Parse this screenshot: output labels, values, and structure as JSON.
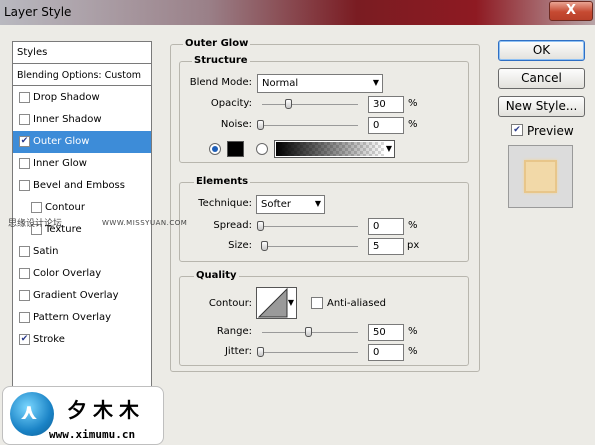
{
  "window": {
    "title": "Layer Style",
    "close_glyph": "X"
  },
  "styles": {
    "header": "Styles",
    "blending": "Blending Options: Custom",
    "items": [
      {
        "label": "Drop Shadow",
        "checked": false,
        "selected": false,
        "indent": false,
        "has_checkbox": true
      },
      {
        "label": "Inner Shadow",
        "checked": false,
        "selected": false,
        "indent": false,
        "has_checkbox": true
      },
      {
        "label": "Outer Glow",
        "checked": true,
        "selected": true,
        "indent": false,
        "has_checkbox": true
      },
      {
        "label": "Inner Glow",
        "checked": false,
        "selected": false,
        "indent": false,
        "has_checkbox": true
      },
      {
        "label": "Bevel and Emboss",
        "checked": false,
        "selected": false,
        "indent": false,
        "has_checkbox": true
      },
      {
        "label": "Contour",
        "checked": false,
        "selected": false,
        "indent": true,
        "has_checkbox": true
      },
      {
        "label": "Texture",
        "checked": false,
        "selected": false,
        "indent": true,
        "has_checkbox": true
      },
      {
        "label": "Satin",
        "checked": false,
        "selected": false,
        "indent": false,
        "has_checkbox": true
      },
      {
        "label": "Color Overlay",
        "checked": false,
        "selected": false,
        "indent": false,
        "has_checkbox": true
      },
      {
        "label": "Gradient Overlay",
        "checked": false,
        "selected": false,
        "indent": false,
        "has_checkbox": true
      },
      {
        "label": "Pattern Overlay",
        "checked": false,
        "selected": false,
        "indent": false,
        "has_checkbox": true
      },
      {
        "label": "Stroke",
        "checked": true,
        "selected": false,
        "indent": false,
        "has_checkbox": true
      }
    ]
  },
  "outer_glow": {
    "title": "Outer Glow",
    "structure": {
      "title": "Structure",
      "blend_mode_label": "Blend Mode:",
      "blend_mode": "Normal",
      "opacity_label": "Opacity:",
      "opacity": "30",
      "opacity_unit": "%",
      "opacity_fraction": 0.3,
      "noise_label": "Noise:",
      "noise": "0",
      "noise_unit": "%",
      "noise_fraction": 0.0,
      "color": "#000000"
    },
    "elements": {
      "title": "Elements",
      "technique_label": "Technique:",
      "technique": "Softer",
      "spread_label": "Spread:",
      "spread": "0",
      "spread_unit": "%",
      "size_label": "Size:",
      "size": "5",
      "size_unit": "px"
    },
    "quality": {
      "title": "Quality",
      "contour_label": "Contour:",
      "anti_aliased_label": "Anti-aliased",
      "anti_aliased": false,
      "range_label": "Range:",
      "range": "50",
      "range_unit": "%",
      "jitter_label": "Jitter:",
      "jitter": "0",
      "jitter_unit": "%"
    }
  },
  "buttons": {
    "ok": "OK",
    "cancel": "Cancel",
    "new_style": "New Style..."
  },
  "preview": {
    "label": "Preview",
    "checked": true
  },
  "watermark": {
    "left_text": "思缘设计论坛",
    "right_text": "WWW.MISSYUAN.COM",
    "logo_text": "夕木木",
    "url": "www.ximumu.cn"
  }
}
